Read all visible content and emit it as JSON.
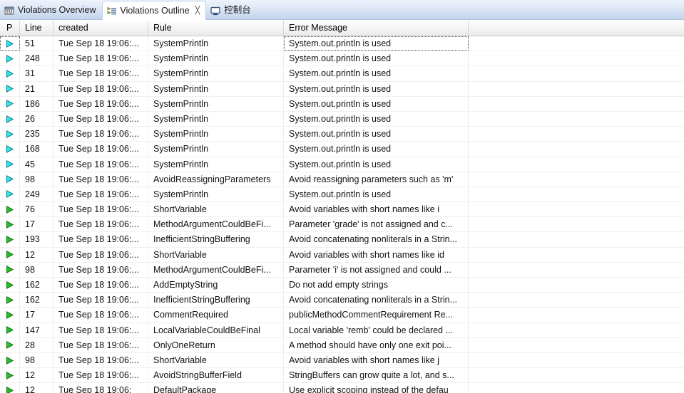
{
  "tabs": [
    {
      "label": "Violations Overview",
      "icon": "violations-overview-icon",
      "active": false,
      "closable": false
    },
    {
      "label": "Violations Outline",
      "icon": "violations-outline-icon",
      "active": true,
      "closable": true,
      "close_glyph": "╳"
    },
    {
      "label": "控制台",
      "icon": "console-icon",
      "active": false,
      "closable": false
    }
  ],
  "table": {
    "columns": [
      {
        "key": "priority",
        "label": "P"
      },
      {
        "key": "line",
        "label": "Line"
      },
      {
        "key": "created",
        "label": "created"
      },
      {
        "key": "rule",
        "label": "Rule"
      },
      {
        "key": "message",
        "label": "Error Message"
      }
    ],
    "priority_colors": {
      "high": "#2ee6f0",
      "low": "#22c322"
    },
    "rows": [
      {
        "priority": "high",
        "line": "51",
        "created": "Tue Sep 18 19:06:...",
        "rule": "SystemPrintln",
        "message": "System.out.println is used",
        "selected": true
      },
      {
        "priority": "high",
        "line": "248",
        "created": "Tue Sep 18 19:06:...",
        "rule": "SystemPrintln",
        "message": "System.out.println is used",
        "selected": false
      },
      {
        "priority": "high",
        "line": "31",
        "created": "Tue Sep 18 19:06:...",
        "rule": "SystemPrintln",
        "message": "System.out.println is used",
        "selected": false
      },
      {
        "priority": "high",
        "line": "21",
        "created": "Tue Sep 18 19:06:...",
        "rule": "SystemPrintln",
        "message": "System.out.println is used",
        "selected": false
      },
      {
        "priority": "high",
        "line": "186",
        "created": "Tue Sep 18 19:06:...",
        "rule": "SystemPrintln",
        "message": "System.out.println is used",
        "selected": false
      },
      {
        "priority": "high",
        "line": "26",
        "created": "Tue Sep 18 19:06:...",
        "rule": "SystemPrintln",
        "message": "System.out.println is used",
        "selected": false
      },
      {
        "priority": "high",
        "line": "235",
        "created": "Tue Sep 18 19:06:...",
        "rule": "SystemPrintln",
        "message": "System.out.println is used",
        "selected": false
      },
      {
        "priority": "high",
        "line": "168",
        "created": "Tue Sep 18 19:06:...",
        "rule": "SystemPrintln",
        "message": "System.out.println is used",
        "selected": false
      },
      {
        "priority": "high",
        "line": "45",
        "created": "Tue Sep 18 19:06:...",
        "rule": "SystemPrintln",
        "message": "System.out.println is used",
        "selected": false
      },
      {
        "priority": "high",
        "line": "98",
        "created": "Tue Sep 18 19:06:...",
        "rule": "AvoidReassigningParameters",
        "message": "Avoid reassigning parameters such as 'm'",
        "selected": false
      },
      {
        "priority": "high",
        "line": "249",
        "created": "Tue Sep 18 19:06:...",
        "rule": "SystemPrintln",
        "message": "System.out.println is used",
        "selected": false
      },
      {
        "priority": "low",
        "line": "76",
        "created": "Tue Sep 18 19:06:...",
        "rule": "ShortVariable",
        "message": "Avoid variables with short names like i",
        "selected": false
      },
      {
        "priority": "low",
        "line": "17",
        "created": "Tue Sep 18 19:06:...",
        "rule": "MethodArgumentCouldBeFi...",
        "message": "Parameter 'grade' is not assigned and c...",
        "selected": false
      },
      {
        "priority": "low",
        "line": "193",
        "created": "Tue Sep 18 19:06:...",
        "rule": "InefficientStringBuffering",
        "message": "Avoid concatenating nonliterals in a Strin...",
        "selected": false
      },
      {
        "priority": "low",
        "line": "12",
        "created": "Tue Sep 18 19:06:...",
        "rule": "ShortVariable",
        "message": "Avoid variables with short names like id",
        "selected": false
      },
      {
        "priority": "low",
        "line": "98",
        "created": "Tue Sep 18 19:06:...",
        "rule": "MethodArgumentCouldBeFi...",
        "message": "Parameter 'i' is not assigned and could ...",
        "selected": false
      },
      {
        "priority": "low",
        "line": "162",
        "created": "Tue Sep 18 19:06:...",
        "rule": "AddEmptyString",
        "message": "Do not add empty strings",
        "selected": false
      },
      {
        "priority": "low",
        "line": "162",
        "created": "Tue Sep 18 19:06:...",
        "rule": "InefficientStringBuffering",
        "message": "Avoid concatenating nonliterals in a Strin...",
        "selected": false
      },
      {
        "priority": "low",
        "line": "17",
        "created": "Tue Sep 18 19:06:...",
        "rule": "CommentRequired",
        "message": "publicMethodCommentRequirement Re...",
        "selected": false
      },
      {
        "priority": "low",
        "line": "147",
        "created": "Tue Sep 18 19:06:...",
        "rule": "LocalVariableCouldBeFinal",
        "message": "Local variable 'remb' could be declared ...",
        "selected": false
      },
      {
        "priority": "low",
        "line": "28",
        "created": "Tue Sep 18 19:06:...",
        "rule": "OnlyOneReturn",
        "message": "A method should have only one exit poi...",
        "selected": false
      },
      {
        "priority": "low",
        "line": "98",
        "created": "Tue Sep 18 19:06:...",
        "rule": "ShortVariable",
        "message": "Avoid variables with short names like j",
        "selected": false
      },
      {
        "priority": "low",
        "line": "12",
        "created": "Tue Sep 18 19:06:...",
        "rule": "AvoidStringBufferField",
        "message": "StringBuffers can grow quite a lot, and s...",
        "selected": false
      },
      {
        "priority": "low",
        "line": "12",
        "created": "Tue Sep 18 19:06:",
        "rule": "DefaultPackage",
        "message": "Use explicit scoping instead of the defau",
        "selected": false
      }
    ]
  }
}
